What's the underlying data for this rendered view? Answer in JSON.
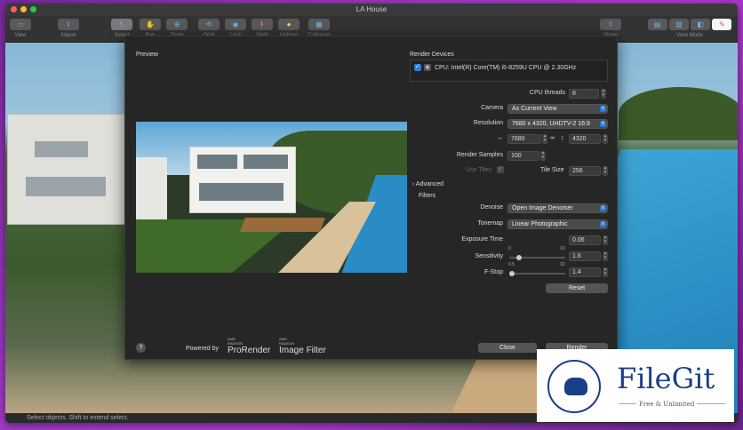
{
  "window": {
    "title": "LA House"
  },
  "toolbar": {
    "items": [
      {
        "label": "View"
      },
      {
        "label": "Import"
      },
      {
        "label": "Select"
      },
      {
        "label": "Pan"
      },
      {
        "label": "Zoom"
      },
      {
        "label": "Orbit"
      },
      {
        "label": "Look"
      },
      {
        "label": "Walk"
      },
      {
        "label": "Lighting"
      },
      {
        "label": "Collisions"
      },
      {
        "label": "Share"
      },
      {
        "label": "View Mode"
      }
    ]
  },
  "status": {
    "text": "Select objects. Shift to extend select."
  },
  "dialog": {
    "preview_label": "Preview",
    "render_devices_label": "Render Devices",
    "device_name": "CPU: Intel(R) Core(TM) i5-8259U CPU @ 2.30GHz",
    "cpu_threads_label": "CPU threads",
    "cpu_threads_value": "8",
    "camera_label": "Camera",
    "camera_value": "As Current View",
    "resolution_label": "Resolution",
    "resolution_value": "7680 x 4320, UHDTV-2 16:9",
    "width_value": "7680",
    "height_value": "4320",
    "render_samples_label": "Render Samples",
    "render_samples_value": "100",
    "use_tiles_label": "Use Tiles",
    "tile_size_label": "Tile Size",
    "tile_size_value": "256",
    "advanced_label": "Advanced",
    "filters_label": "Filters",
    "denoise_label": "Denoise",
    "denoise_value": "Open Image Denoiser",
    "tonemap_label": "Tonemap",
    "tonemap_value": "Linear Photographic",
    "exposure_label": "Exposure Time",
    "exposure_value": "0.06",
    "sensitivity_label": "Sensitivity",
    "sensitivity_min": "0",
    "sensitivity_max": "10",
    "sensitivity_value": "1.6",
    "fstop_label": "F-Stop",
    "fstop_min": "0.5",
    "fstop_max": "32",
    "fstop_value": "1.4",
    "reset_label": "Reset",
    "help_label": "?",
    "powered_by": "Powered by",
    "amd1": "AMD",
    "radeon1": "RADEON",
    "prorender": "ProRender",
    "amd2": "AMD",
    "radeon2": "RADEON",
    "image_filter": "Image Filter",
    "close_label": "Close",
    "render_label": "Render"
  },
  "watermark": {
    "title": "FileGit",
    "subtitle": "Free & Unlimited"
  },
  "colors": {
    "accent": "#2f7bd9",
    "brand": "#1a3f86"
  }
}
